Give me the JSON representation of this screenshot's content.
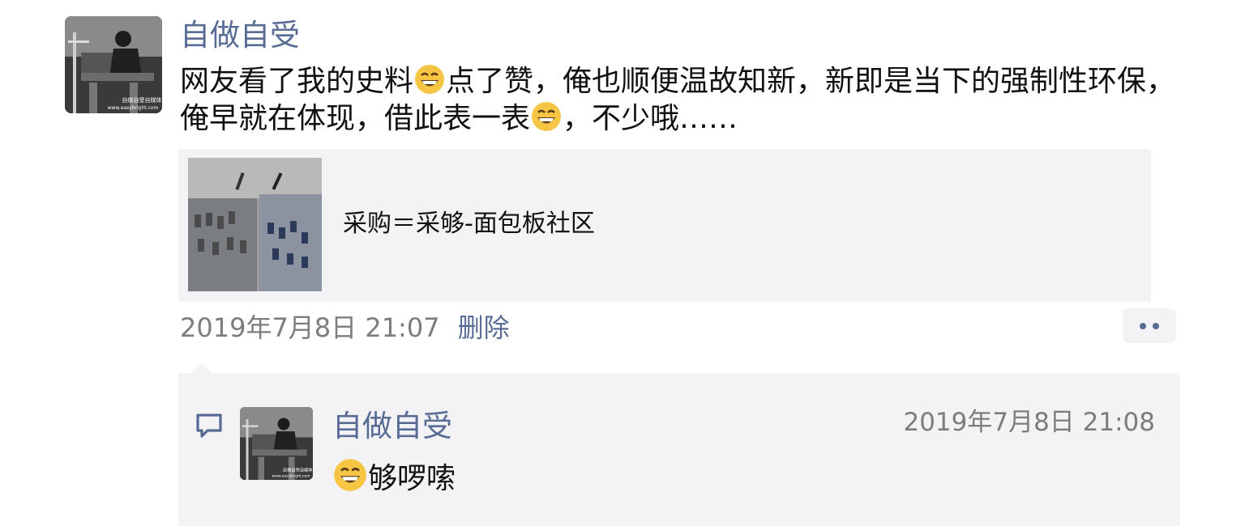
{
  "post": {
    "author": "自做自受",
    "text_parts": [
      "网友看了我的史料",
      "点了赞，俺也顺便温故知新，新即是当下的强制性环保，俺早就在体现，借此表一表",
      "，不少哦……"
    ],
    "emoji": "grinning-face-emoji",
    "avatar_caption": "自做自受自媒体",
    "avatar_url_text": "www.easybright.com",
    "timestamp": "2019年7月8日 21:07",
    "delete_label": "删除"
  },
  "link_card": {
    "title": "采购＝采够-面包板社区"
  },
  "comment": {
    "author": "自做自受",
    "time": "2019年7月8日 21:08",
    "text": "够啰嗦",
    "icon": "comment-bubble-icon"
  },
  "colors": {
    "name_blue": "#576b95",
    "meta_gray": "#7d7d7d",
    "panel_bg": "#f3f3f5",
    "text": "#111111"
  }
}
